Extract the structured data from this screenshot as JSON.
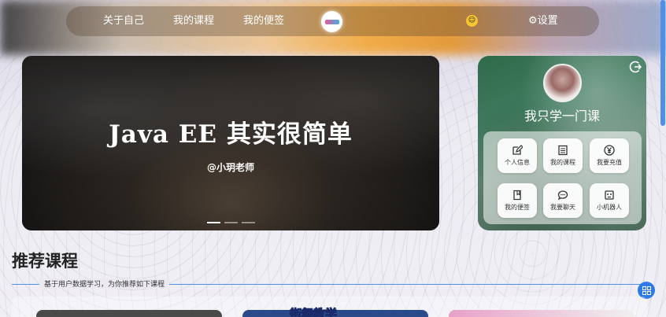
{
  "nav": {
    "items": [
      "关于自己",
      "我的课程",
      "我的便签"
    ],
    "settings": "⚙设置"
  },
  "banner": {
    "title": "Java EE 其实很简单",
    "author": "@小玥老师",
    "slides": 3,
    "active_slide": 1
  },
  "profile": {
    "name": "我只学一门课",
    "menu": [
      {
        "label": "个人信息",
        "icon": "edit-icon"
      },
      {
        "label": "我的课程",
        "icon": "list-icon"
      },
      {
        "label": "我要充值",
        "icon": "yen-icon"
      },
      {
        "label": "我的便签",
        "icon": "note-icon"
      },
      {
        "label": "我要聊天",
        "icon": "chat-icon"
      },
      {
        "label": "小机器人",
        "icon": "robot-icon"
      }
    ]
  },
  "section": {
    "title": "推荐课程",
    "subtitle": "基于用户数据学习，为你推荐如下课程"
  },
  "courses": {
    "card2_text": "街舞教学"
  },
  "colors": {
    "accent": "#2f7be6",
    "line": "#4f8fe8"
  }
}
